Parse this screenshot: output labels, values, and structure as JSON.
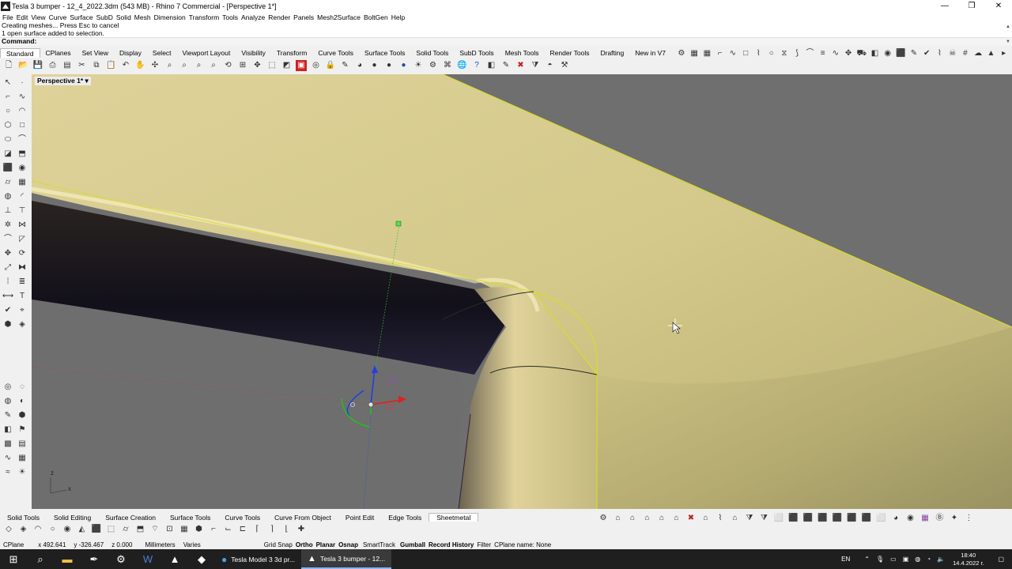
{
  "window": {
    "title": "Tesla 3 bumper - 12_4_2022.3dm (543 MB) - Rhino 7 Commercial - [Perspective 1*]",
    "minimize": "—",
    "maximize": "❐",
    "close": "✕"
  },
  "menu": [
    "File",
    "Edit",
    "View",
    "Curve",
    "Surface",
    "SubD",
    "Solid",
    "Mesh",
    "Dimension",
    "Transform",
    "Tools",
    "Analyze",
    "Render",
    "Panels",
    "Mesh2Surface",
    "BoltGen",
    "Help"
  ],
  "command": {
    "history": [
      "Creating meshes... Press Esc to cancel",
      "1 open surface added to selection."
    ],
    "prompt": "Command:"
  },
  "top_tabs": [
    "Standard",
    "CPlanes",
    "Set View",
    "Display",
    "Select",
    "Viewport Layout",
    "Visibility",
    "Transform",
    "Curve Tools",
    "Surface Tools",
    "Solid Tools",
    "SubD Tools",
    "Mesh Tools",
    "Render Tools",
    "Drafting",
    "New in V7"
  ],
  "top_tab_active": "Standard",
  "viewport": {
    "label": "Perspective 1*",
    "dropdown": "▾",
    "axis_x": "x",
    "axis_z": "z"
  },
  "bottom_tabs": [
    "Solid Tools",
    "Solid Editing",
    "Surface Creation",
    "Surface Tools",
    "Curve Tools",
    "Curve From Object",
    "Point Edit",
    "Edge Tools",
    "Sheetmetal"
  ],
  "bottom_tab_active": "Sheetmetal",
  "status": {
    "cplane": "CPlane",
    "x": "x 492.641",
    "y": "y -326.467",
    "z": "z 0.000",
    "units": "Millimeters",
    "layer": "Varies",
    "grid_snap": "Grid Snap",
    "ortho": "Ortho",
    "planar": "Planar",
    "osnap": "Osnap",
    "smarttrack": "SmartTrack",
    "gumball": "Gumball",
    "record_history": "Record History",
    "filter": "Filter",
    "cplane_name": "CPlane name: None"
  },
  "taskbar": {
    "tasks": [
      "Tesla Model 3 3d pr...",
      "Tesla 3 bumper - 12..."
    ],
    "lang": "EN",
    "time": "18:40",
    "date": "14.4.2022 г."
  },
  "colors": {
    "viewport_bg": "#6f6f6f",
    "surface_yellow": "#d8cc86",
    "selection_yellow": "#e8e000",
    "gumball_red": "#e02020",
    "gumball_green": "#20c020",
    "gumball_blue": "#2040e0"
  }
}
